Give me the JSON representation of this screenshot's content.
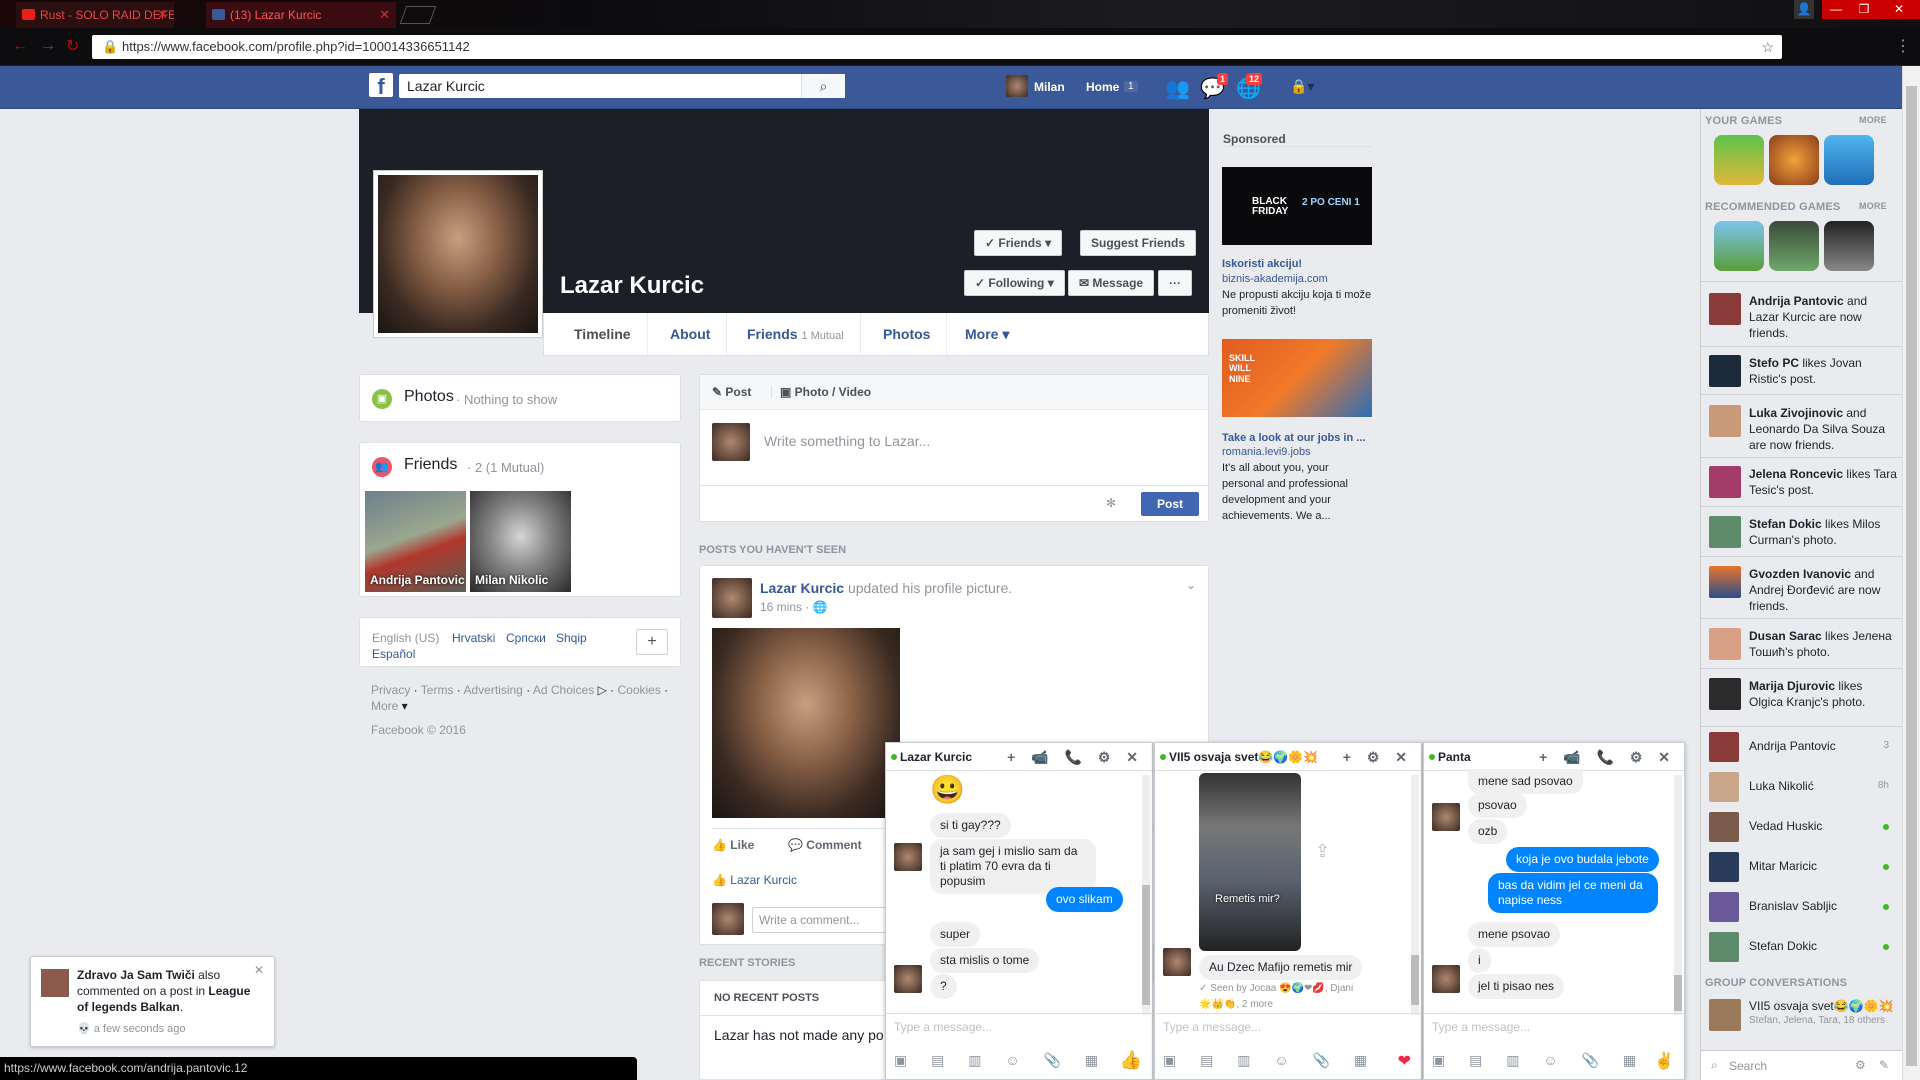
{
  "browser": {
    "tabs": [
      {
        "title": "Rust - SOLO RAID DEFE",
        "icon": "youtube-icon"
      },
      {
        "title": "(13) Lazar Kurcic",
        "icon": "facebook-icon"
      }
    ],
    "url": "https://www.facebook.com/profile.php?id=100014336651142",
    "status_url": "https://www.facebook.com/andrija.pantovic.12"
  },
  "topbar": {
    "search_value": "Lazar Kurcic",
    "user_name": "Milan",
    "home_label": "Home",
    "home_count": "1",
    "messages_badge": "1",
    "notifications_badge": "12"
  },
  "profile": {
    "name": "Lazar Kurcic",
    "friends_btn": "Friends",
    "suggest_btn": "Suggest Friends",
    "following_btn": "Following",
    "message_btn": "Message",
    "more_btn": "···",
    "tabs": {
      "timeline": "Timeline",
      "about": "About",
      "friends": "Friends",
      "friends_mutual": "1 Mutual",
      "photos": "Photos",
      "more": "More"
    }
  },
  "left_col": {
    "photos_title": "Photos",
    "photos_sub": "· Nothing to show",
    "friends_title": "Friends",
    "friends_sub": "· 2 (1 Mutual)",
    "friends": [
      {
        "name": "Andrija Pantovic"
      },
      {
        "name": "Milan Nikolic"
      }
    ],
    "languages": {
      "current": "English (US)",
      "others": [
        "Hrvatski",
        "Српски",
        "Shqip",
        "Español"
      ]
    },
    "footer_links": [
      "Privacy",
      "Terms",
      "Advertising",
      "Ad Choices",
      "Cookies",
      "More"
    ],
    "copyright": "Facebook © 2016"
  },
  "composer": {
    "post_tab": "Post",
    "photo_tab": "Photo / Video",
    "placeholder": "Write something to Lazar...",
    "post_button": "Post"
  },
  "feed": {
    "section_label": "POSTS YOU HAVEN'T SEEN",
    "post": {
      "author": "Lazar Kurcic",
      "action": "updated his profile picture.",
      "time": "16 mins",
      "like": "Like",
      "comment": "Comment",
      "liker": "Lazar Kurcic",
      "comment_placeholder": "Write a comment..."
    },
    "recent_label": "RECENT STORIES",
    "no_recent": "NO RECENT POSTS",
    "no_recent_text": "Lazar has not made any po"
  },
  "sponsored": {
    "label": "Sponsored",
    "ads": [
      {
        "banner_text_1": "BLACK FRIDAY",
        "banner_text_2": "2 PO CENI 1",
        "title": "Iskoristi akciju!",
        "domain": "biznis-akademija.com",
        "body": "Ne propusti akciju koja ti može promeniti život!"
      },
      {
        "banner_text_1": "SKILL",
        "banner_text_2": "WILL",
        "banner_text_3": "NINE",
        "title": "Take a look at our jobs in ...",
        "domain": "romania.levi9.jobs",
        "body": "It's all about you, your personal and professional development and your achievements. We a..."
      }
    ]
  },
  "right_sidebar": {
    "your_games": "YOUR GAMES",
    "recommended": "RECOMMENDED GAMES",
    "more": "MORE",
    "ticker": [
      {
        "name": "Andrija Pantovic",
        "text": " and Lazar Kurcic are now friends."
      },
      {
        "name": "Stefo PC",
        "text": " likes Jovan Ristic's post."
      },
      {
        "name": "Luka Zivojinovic",
        "text": " and Leonardo Da Silva Souza are now friends."
      },
      {
        "name": "Jelena Roncevic",
        "text": " likes Tara Tesic's post."
      },
      {
        "name": "Stefan Dokic",
        "text": " likes Milos Curman's photo."
      },
      {
        "name": "Gvozden Ivanovic",
        "text": " and Andrej Đorđević are now friends."
      },
      {
        "name": "Dusan Sarac",
        "text": " likes Јелена Тошић's photo."
      },
      {
        "name": "Marija Djurovic",
        "text": " likes Olgica Kranjc's photo."
      }
    ],
    "contacts": [
      {
        "name": "Andrija Pantovic",
        "meta": "3"
      },
      {
        "name": "Luka Nikolić",
        "meta": "8h"
      },
      {
        "name": "Vedad Huskic",
        "meta": ""
      },
      {
        "name": "Mitar Maricic",
        "meta": ""
      },
      {
        "name": "Branislav Sabljic",
        "meta": ""
      },
      {
        "name": "Stefan Dokic",
        "meta": ""
      }
    ],
    "group_label": "GROUP CONVERSATIONS",
    "group": {
      "name": "VII5 osvaja svet😂🌍🌼💥",
      "members": "Stefan, Jelena, Tara, 18 others"
    },
    "search_placeholder": "Search"
  },
  "chats": [
    {
      "name": "Lazar Kurcic",
      "messages": [
        "😀",
        "si ti gay???",
        "ja sam gej i mislio sam da ti platim 70 evra da ti popusim",
        "ovo slikam",
        "super",
        "sta mislis o tome",
        "?"
      ],
      "placeholder": "Type a message..."
    },
    {
      "name": "VII5 osvaja svet😂🌍🌼💥",
      "photo_caption": "Remetis mir?",
      "messages": [
        "Au Dzec Mafijo remetis mir"
      ],
      "seen": "Seen by Jocaa",
      "seen_more": "Djani",
      "more": "2 more",
      "placeholder": "Type a message..."
    },
    {
      "name": "Panta",
      "messages": [
        "mene sad psovao",
        "psovao",
        "ozb",
        "koja je ovo budala jebote",
        "bas da vidim jel ce meni da napise ness",
        "mene psovao",
        "i",
        "jel ti pisao nes"
      ],
      "placeholder": "Type a message..."
    }
  ],
  "notification": {
    "name": "Zdravo Ja Sam Twiči",
    "text": " also commented on a post in ",
    "group": "League of legends Balkan",
    "time": "a few seconds ago"
  }
}
